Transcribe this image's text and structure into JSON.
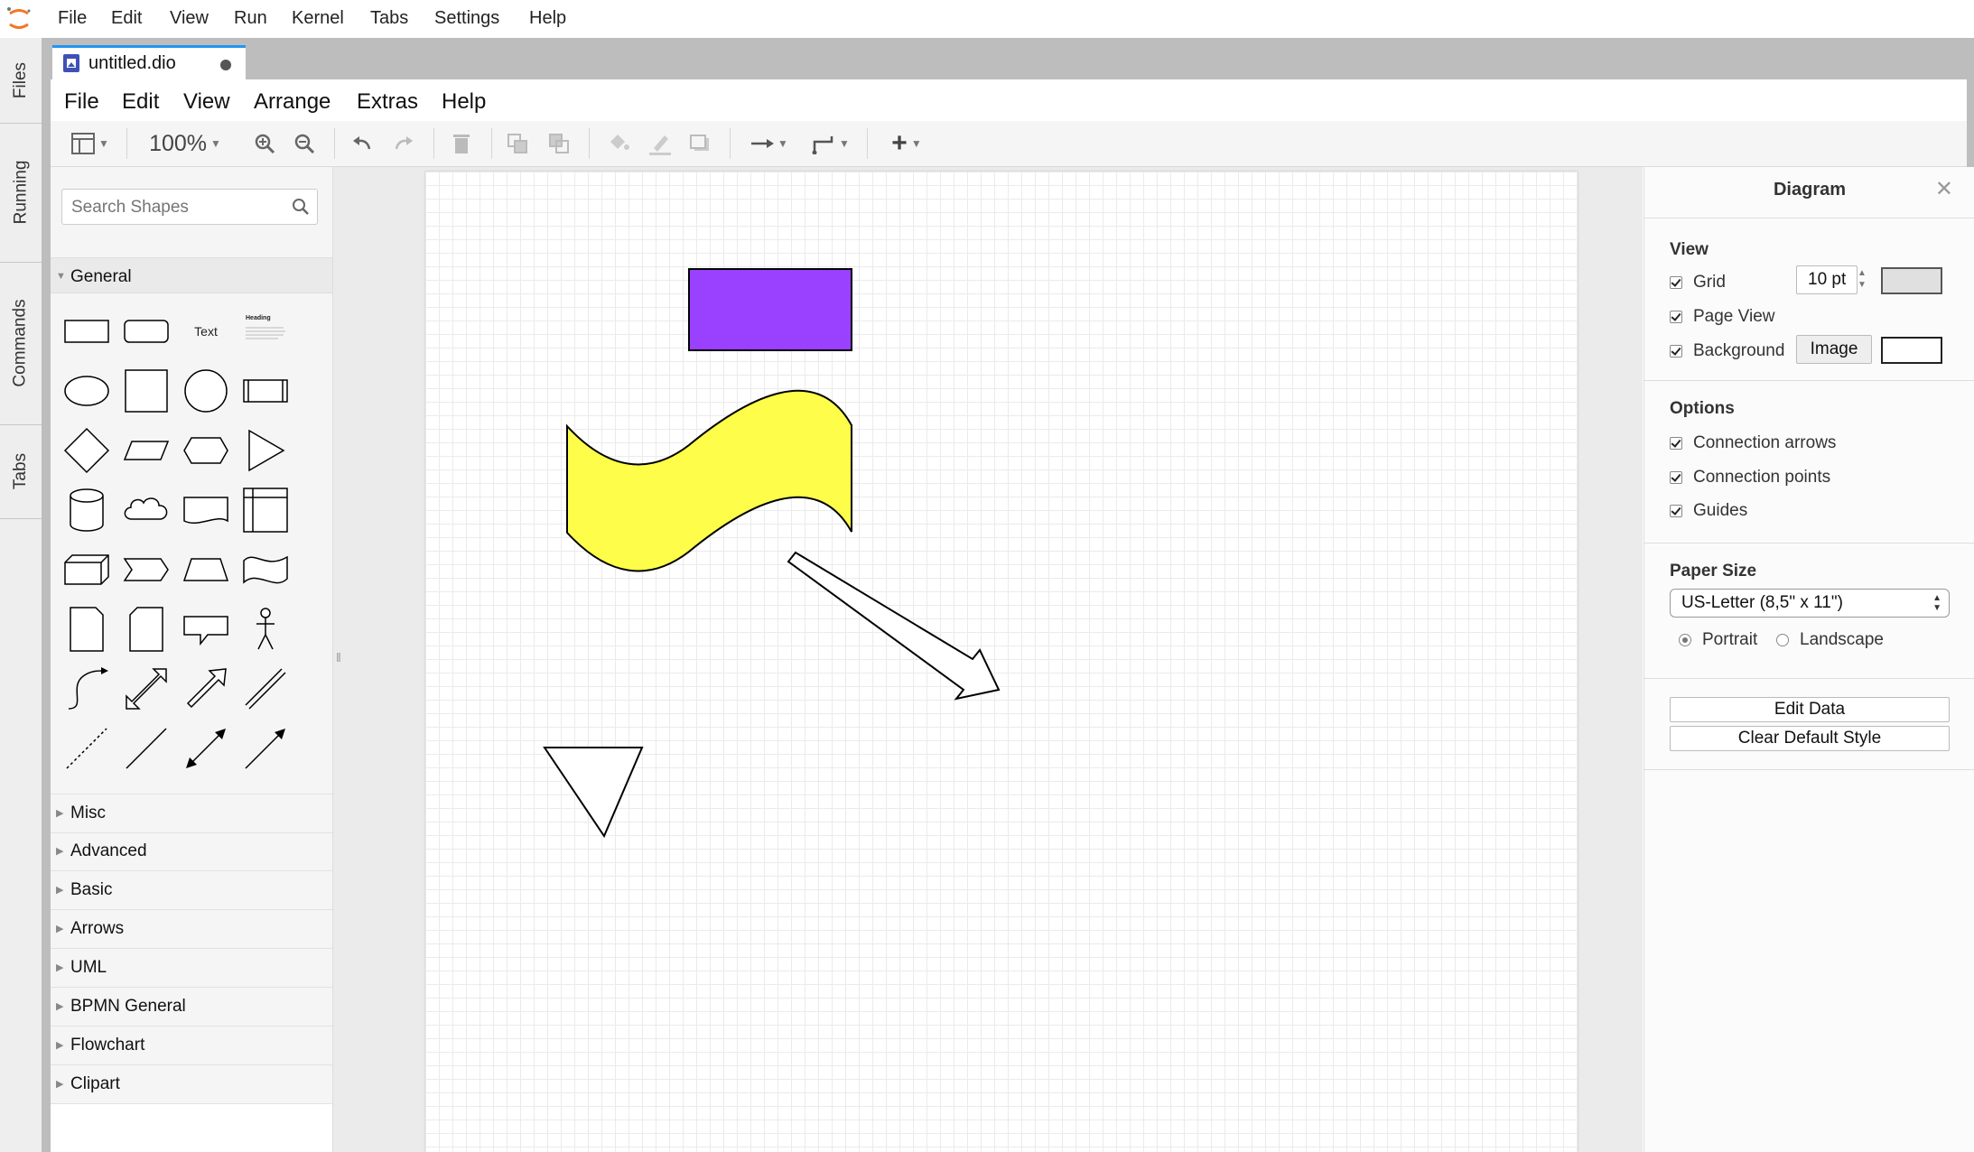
{
  "jupyter_menu": [
    "File",
    "Edit",
    "View",
    "Run",
    "Kernel",
    "Tabs",
    "Settings",
    "Help"
  ],
  "left_tabs": [
    "Files",
    "Running",
    "Commands",
    "Tabs"
  ],
  "doc_tab": {
    "title": "untitled.dio"
  },
  "drawio_menu": [
    "File",
    "Edit",
    "View",
    "Arrange",
    "Extras",
    "Help"
  ],
  "toolbar": {
    "zoom": "100%"
  },
  "shapes": {
    "search_placeholder": "Search Shapes",
    "general_label": "General",
    "text_shape_label": "Text",
    "heading_shape_label": "Heading",
    "sections": [
      "Misc",
      "Advanced",
      "Basic",
      "Arrows",
      "UML",
      "BPMN General",
      "Flowchart",
      "Clipart"
    ]
  },
  "format": {
    "title": "Diagram",
    "close_glyph": "✕",
    "view_heading": "View",
    "grid_label": "Grid",
    "grid_size": "10 pt",
    "page_view_label": "Page View",
    "background_label": "Background",
    "image_button": "Image",
    "options_heading": "Options",
    "connection_arrows": "Connection arrows",
    "connection_points": "Connection points",
    "guides": "Guides",
    "paper_size_heading": "Paper Size",
    "paper_size_value": "US-Letter (8,5\" x 11\")",
    "portrait": "Portrait",
    "landscape": "Landscape",
    "edit_data": "Edit Data",
    "clear_default_style": "Clear Default Style"
  },
  "colors": {
    "rect_fill": "#9a40ff",
    "wave_fill": "#fdfd4a",
    "tab_accent": "#2196f3"
  }
}
